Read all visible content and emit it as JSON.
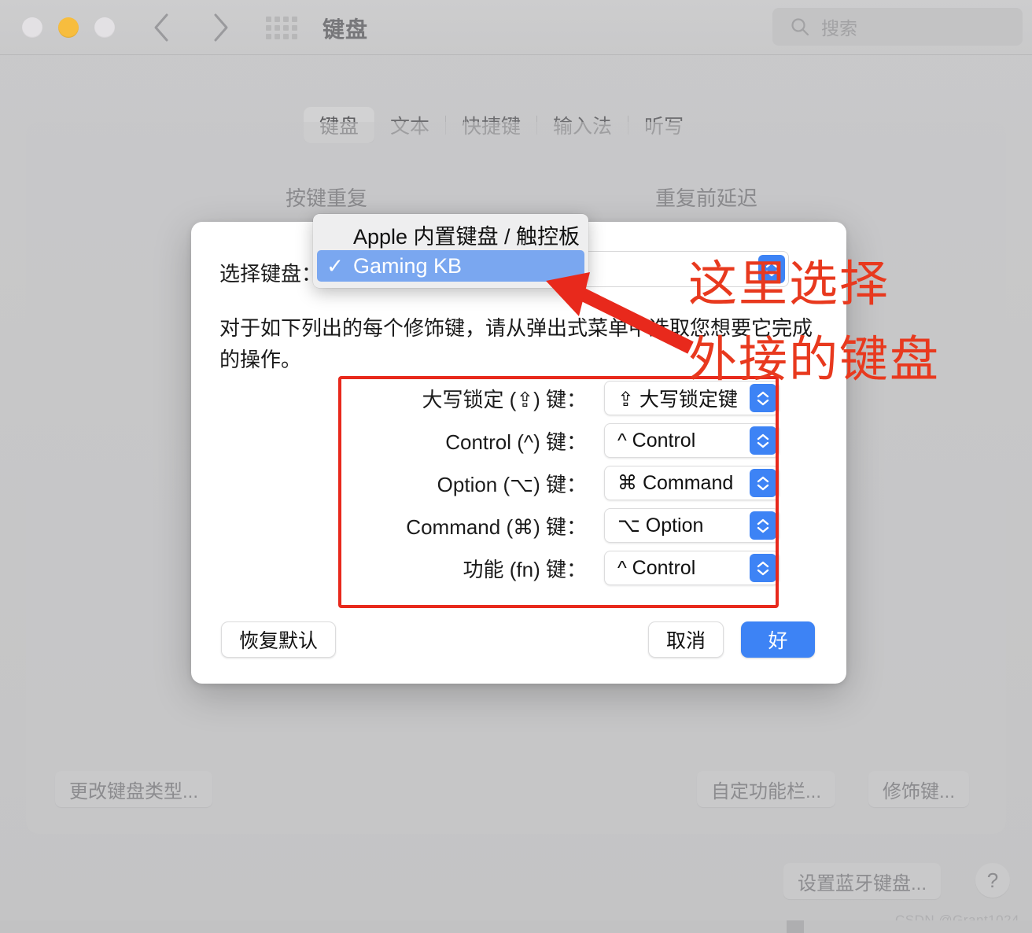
{
  "window": {
    "title": "键盘",
    "traffic_lights": [
      "close-inactive",
      "minimize",
      "zoom-inactive"
    ],
    "back_icon": "chevron-left-icon",
    "forward_icon": "chevron-right-icon",
    "grid_icon": "grid-apps-icon"
  },
  "search": {
    "placeholder": "搜索",
    "icon": "search-icon"
  },
  "tabs": [
    {
      "label": "键盘",
      "selected": true
    },
    {
      "label": "文本",
      "selected": false
    },
    {
      "label": "快捷键",
      "selected": false
    },
    {
      "label": "输入法",
      "selected": false
    },
    {
      "label": "听写",
      "selected": false
    }
  ],
  "main": {
    "section_labels": {
      "key_repeat": "按键重复",
      "delay_until_repeat": "重复前延迟"
    },
    "buttons": {
      "change_keyboard_type": "更改键盘类型...",
      "customize_touch_bar": "自定功能栏...",
      "modifier_keys": "修饰键...",
      "set_up_bluetooth_keyboard": "设置蓝牙键盘...",
      "help": "?"
    }
  },
  "modal": {
    "choose_keyboard_label": "选择键盘：",
    "selected_keyboard": "Gaming KB",
    "description": "对于如下列出的每个修饰键，请从弹出式菜单中选取您想要它完成的操作。",
    "modifier_rows": [
      {
        "label": "大写锁定 (⇪) 键：",
        "value": "⇪ 大写锁定键"
      },
      {
        "label": "Control (^) 键：",
        "value": "^ Control"
      },
      {
        "label": "Option (⌥) 键：",
        "value": "⌘ Command"
      },
      {
        "label": "Command (⌘) 键：",
        "value": "⌥ Option"
      },
      {
        "label": "功能 (fn) 键：",
        "value": "^ Control"
      }
    ],
    "buttons": {
      "restore_defaults": "恢复默认",
      "cancel": "取消",
      "ok": "好"
    }
  },
  "dropdown": {
    "items": [
      {
        "label": "Apple 内置键盘 / 触控板",
        "checked": false,
        "highlighted": false
      },
      {
        "label": "Gaming KB",
        "checked": true,
        "highlighted": true
      }
    ],
    "check_glyph": "✓"
  },
  "annotations": {
    "line1": "这里选择",
    "line2": "外接的键盘",
    "arrow": "red-arrow-icon",
    "color": "#e8391e"
  },
  "watermark": "CSDN @Grant1024",
  "colors": {
    "accent_blue": "#3d83f5",
    "highlight_blue": "#7aa7f0",
    "annotation_red": "#e8391e",
    "frame_red": "#e8291c"
  }
}
